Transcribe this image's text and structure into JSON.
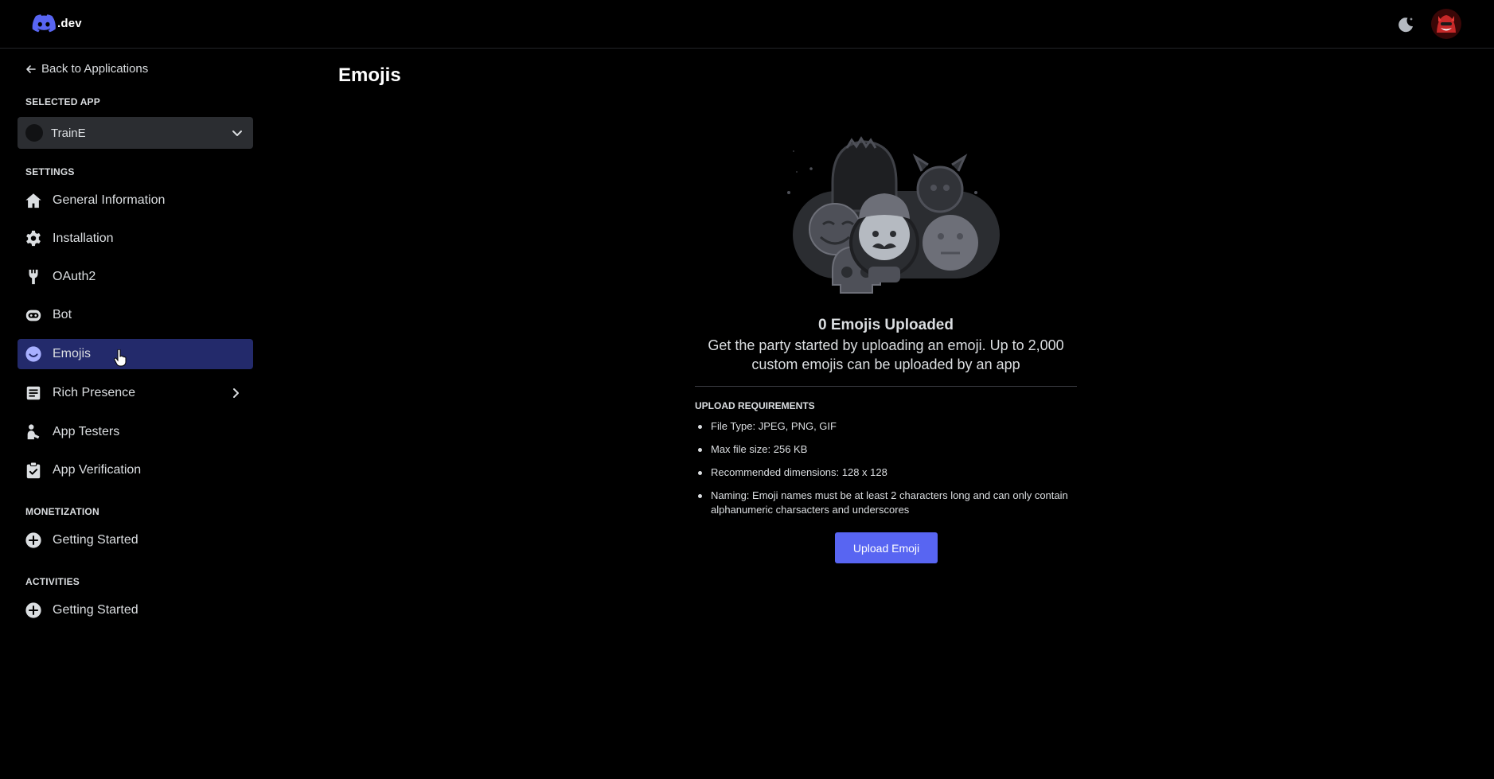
{
  "header": {
    "logo_text": ".dev",
    "theme_icon": "moon-icon",
    "avatar_icon": "user-avatar"
  },
  "sidebar": {
    "back_label": "Back to Applications",
    "selected_app_label": "SELECTED APP",
    "selected_app_value": "TrainE",
    "settings_label": "SETTINGS",
    "items": [
      {
        "label": "General Information",
        "icon": "home-icon"
      },
      {
        "label": "Installation",
        "icon": "gear-icon"
      },
      {
        "label": "OAuth2",
        "icon": "wrench-icon"
      },
      {
        "label": "Bot",
        "icon": "robot-icon"
      },
      {
        "label": "Emojis",
        "icon": "smiley-icon",
        "active": true
      },
      {
        "label": "Rich Presence",
        "icon": "document-icon",
        "expandable": true
      },
      {
        "label": "App Testers",
        "icon": "person-icon"
      },
      {
        "label": "App Verification",
        "icon": "clipboard-check-icon"
      }
    ],
    "monetization_label": "MONETIZATION",
    "monetization_items": [
      {
        "label": "Getting Started",
        "icon": "plus-circle-icon"
      }
    ],
    "activities_label": "ACTIVITIES",
    "activities_items": [
      {
        "label": "Getting Started",
        "icon": "plus-circle-icon"
      }
    ]
  },
  "main": {
    "title": "Emojis",
    "empty_title": "0 Emojis Uploaded",
    "empty_desc": "Get the party started by uploading an emoji. Up to 2,000 custom emojis can be uploaded by an app",
    "requirements_title": "UPLOAD REQUIREMENTS",
    "requirements": [
      "File Type: JPEG, PNG, GIF",
      "Max file size: 256 KB",
      "Recommended dimensions: 128 x 128",
      "Naming: Emoji names must be at least 2 characters long and can only contain alphanumeric charsacters and underscores"
    ],
    "upload_button": "Upload Emoji"
  },
  "colors": {
    "accent": "#5865f2",
    "active_nav": "#232a6b",
    "background": "#000000"
  }
}
